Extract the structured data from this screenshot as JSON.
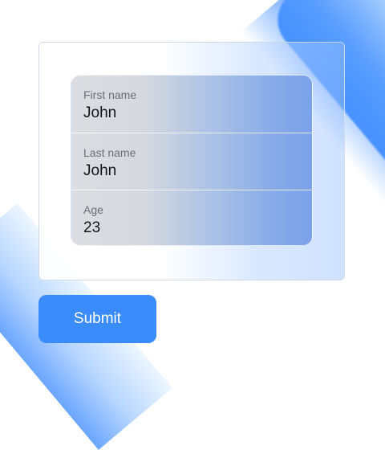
{
  "form": {
    "fields": [
      {
        "label": "First name",
        "value": "John"
      },
      {
        "label": "Last name",
        "value": "John"
      },
      {
        "label": "Age",
        "value": "23"
      }
    ],
    "submit_label": "Submit"
  },
  "colors": {
    "accent": "#3a8bfb",
    "label_text": "#6c6e74",
    "value_text": "#141518"
  }
}
